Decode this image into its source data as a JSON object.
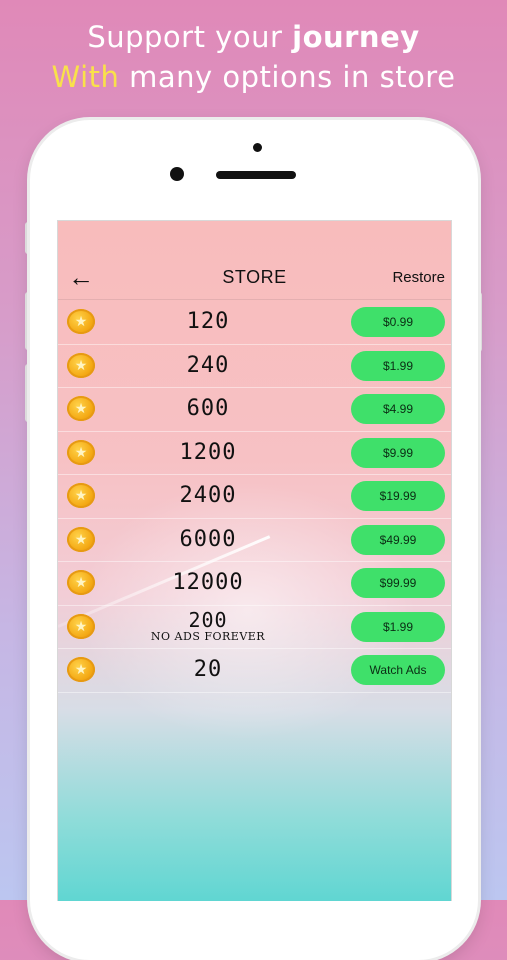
{
  "promo": {
    "line1_prefix": "Support your ",
    "line1_emphasis": "journey",
    "line2_accent": "With",
    "line2_rest": " many options in store"
  },
  "store": {
    "title": "STORE",
    "restore_label": "Restore",
    "back_icon": "←"
  },
  "items": [
    {
      "amount": "120",
      "price": "$0.99"
    },
    {
      "amount": "240",
      "price": "$1.99"
    },
    {
      "amount": "600",
      "price": "$4.99"
    },
    {
      "amount": "1200",
      "price": "$9.99"
    },
    {
      "amount": "2400",
      "price": "$19.99"
    },
    {
      "amount": "6000",
      "price": "$49.99"
    },
    {
      "amount": "12000",
      "price": "$99.99"
    },
    {
      "amount": "200",
      "note": "NO ADS FOREVER",
      "price": "$1.99"
    },
    {
      "amount": "20",
      "price": "Watch Ads"
    }
  ],
  "coin_icon": "★",
  "colors": {
    "accent_yellow": "#f9e14a",
    "button_green": "#3fe06a",
    "coin_gold": "#f4a914"
  }
}
